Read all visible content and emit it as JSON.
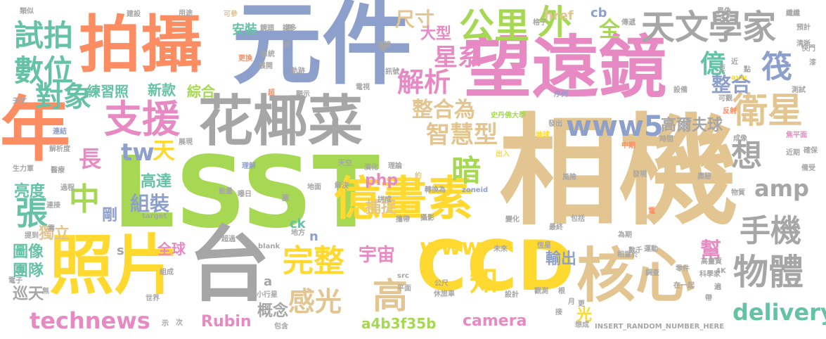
{
  "wordcloud": {
    "words": [
      {
        "text": "相機",
        "color": "#e2c590"
      },
      {
        "text": "LSST",
        "color": "#a6d854"
      },
      {
        "text": "元件",
        "color": "#8da0cb"
      },
      {
        "text": "望遠鏡",
        "color": "#e78ac3"
      },
      {
        "text": "拍攝",
        "color": "#fc8d62"
      },
      {
        "text": "花椰菜",
        "color": "#a6a6a6"
      },
      {
        "text": "CCD",
        "color": "#ffd92f"
      },
      {
        "text": "年",
        "color": "#fc8d62"
      },
      {
        "text": "照片",
        "color": "#ffd92f"
      },
      {
        "text": "台",
        "color": "#a6a6a6"
      },
      {
        "text": "核心",
        "color": "#e2c590"
      },
      {
        "text": "億畫素",
        "color": "#ffd92f"
      },
      {
        "text": "天文學家",
        "color": "#a6a6a6"
      },
      {
        "text": "公里",
        "color": "#a6d854"
      },
      {
        "text": "外",
        "color": "#a6d854"
      },
      {
        "text": "支援",
        "color": "#e78ac3"
      },
      {
        "text": "衛星",
        "color": "#e2c590"
      },
      {
        "text": "www5",
        "color": "#8da0cb"
      },
      {
        "text": "試拍",
        "color": "#66c2a5"
      },
      {
        "text": "數位",
        "color": "#66c2a5"
      },
      {
        "text": "對象",
        "color": "#66c2a5"
      },
      {
        "text": "億",
        "color": "#66c2a5"
      },
      {
        "text": "筏",
        "color": "#8da0cb"
      },
      {
        "text": "星系",
        "color": "#e78ac3"
      },
      {
        "text": "解析",
        "color": "#e78ac3"
      },
      {
        "text": "尺寸",
        "color": "#e2c590"
      },
      {
        "text": "大型",
        "color": "#e78ac3"
      },
      {
        "text": "全",
        "color": "#a6d854"
      },
      {
        "text": "整合",
        "color": "#8da0cb"
      },
      {
        "text": "整合為",
        "color": "#e2c590"
      },
      {
        "text": "智慧型",
        "color": "#e2c590"
      },
      {
        "text": "高爾夫球",
        "color": "#a6a6a6"
      },
      {
        "text": "想",
        "color": "#a6a6a6"
      },
      {
        "text": "amp",
        "color": "#a6a6a6"
      },
      {
        "text": "手機",
        "color": "#a6a6a6"
      },
      {
        "text": "物體",
        "color": "#a6a6a6"
      },
      {
        "text": "delivery",
        "color": "#66c2a5"
      },
      {
        "text": "tw",
        "color": "#8da0cb"
      },
      {
        "text": "天",
        "color": "#ffd92f"
      },
      {
        "text": "長",
        "color": "#e78ac3"
      },
      {
        "text": "暗",
        "color": "#a6d854"
      },
      {
        "text": "php",
        "color": "#e78ac3"
      },
      {
        "text": "中",
        "color": "#a6d854"
      },
      {
        "text": "張",
        "color": "#66c2a5"
      },
      {
        "text": "亮度",
        "color": "#66c2a5"
      },
      {
        "text": "高達",
        "color": "#66c2a5"
      },
      {
        "text": "組裝",
        "color": "#8da0cb"
      },
      {
        "text": "剛",
        "color": "#8da0cb"
      },
      {
        "text": "獨立",
        "color": "#e2c590"
      },
      {
        "text": "圖像",
        "color": "#66c2a5"
      },
      {
        "text": "團隊",
        "color": "#66c2a5"
      },
      {
        "text": "巡天",
        "color": "#a6a6a6"
      },
      {
        "text": "technews",
        "color": "#e78ac3"
      },
      {
        "text": "Rubin",
        "color": "#e78ac3"
      },
      {
        "text": "概念",
        "color": "#a6a6a6"
      },
      {
        "text": "完整",
        "color": "#ffd92f"
      },
      {
        "text": "感光",
        "color": "#e2c590"
      },
      {
        "text": "高",
        "color": "#e2c590"
      },
      {
        "text": "宇宙",
        "color": "#e78ac3"
      },
      {
        "text": "www",
        "color": "#ffd92f"
      },
      {
        "text": "知",
        "color": "#ffd92f"
      },
      {
        "text": "camera",
        "color": "#e78ac3"
      },
      {
        "text": "a4b3f35b",
        "color": "#a6d854"
      },
      {
        "text": "捕捉",
        "color": "#e2c590"
      },
      {
        "text": "輸出",
        "color": "#8da0cb"
      },
      {
        "text": "幫",
        "color": "#e78ac3"
      },
      {
        "text": "光",
        "color": "#ffd92f"
      },
      {
        "text": "全球",
        "color": "#e78ac3"
      },
      {
        "text": "練習照",
        "color": "#66c2a5"
      },
      {
        "text": "新款",
        "color": "#66c2a5"
      },
      {
        "text": "綜合",
        "color": "#a6d854"
      },
      {
        "text": "href",
        "color": "#e2c590"
      },
      {
        "text": "cb",
        "color": "#8da0cb"
      },
      {
        "text": "安裝",
        "color": "#66c2a5"
      },
      {
        "text": "ck",
        "color": "#66c2a5"
      },
      {
        "text": "n",
        "color": "#8da0cb"
      },
      {
        "text": "a",
        "color": "#a6a6a6"
      },
      {
        "text": "s",
        "color": "#a6a6a6"
      },
      {
        "text": "類似",
        "color": "#a6a6a6"
      },
      {
        "text": "建設",
        "color": "#a6a6a6"
      },
      {
        "text": "用途",
        "color": "#a6a6a6"
      },
      {
        "text": "可參",
        "color": "#e2c590"
      },
      {
        "text": "異偽",
        "color": "#a6a6a6"
      },
      {
        "text": "纖纖",
        "color": "#a6a6a6"
      },
      {
        "text": "預計",
        "color": "#a6a6a6"
      },
      {
        "text": "清晰",
        "color": "#a6a6a6"
      },
      {
        "text": "快門",
        "color": "#a6a6a6"
      },
      {
        "text": "測試",
        "color": "#a6a6a6"
      },
      {
        "text": "avw",
        "color": "#ffd92f"
      },
      {
        "text": "設備",
        "color": "#a6a6a6"
      },
      {
        "text": "序列",
        "color": "#8da0cb"
      },
      {
        "text": "電視",
        "color": "#a6a6a6"
      },
      {
        "text": "史丹佛大學",
        "color": "#a6d854"
      },
      {
        "text": "發出",
        "color": "#a6a6a6"
      },
      {
        "text": "焦平面",
        "color": "#e78ac3"
      },
      {
        "text": "反射",
        "color": "#fc8d62"
      },
      {
        "text": "近期",
        "color": "#a6a6a6"
      },
      {
        "text": "確保",
        "color": "#a6a6a6"
      },
      {
        "text": "備受",
        "color": "#a6a6a6"
      },
      {
        "text": "物質",
        "color": "#a6a6a6"
      },
      {
        "text": "奧秘",
        "color": "#a6a6a6"
      },
      {
        "text": "成像",
        "color": "#a6a6a6"
      },
      {
        "text": "發現",
        "color": "#a6a6a6"
      },
      {
        "text": "風險",
        "color": "#a6a6a6"
      },
      {
        "text": "時間",
        "color": "#a6a6a6"
      },
      {
        "text": "中期",
        "color": "#fc8d62"
      },
      {
        "text": "地球",
        "color": "#ffd92f"
      },
      {
        "text": "出入",
        "color": "#ffd92f"
      },
      {
        "text": "生力軍",
        "color": "#a6a6a6"
      },
      {
        "text": "天文",
        "color": "#a6a6a6"
      },
      {
        "text": "醫療",
        "color": "#a6a6a6"
      },
      {
        "text": "連結",
        "color": "#8da0cb"
      },
      {
        "text": "解析度",
        "color": "#a6a6a6"
      },
      {
        "text": "展現",
        "color": "#a6a6a6"
      },
      {
        "text": "理解",
        "color": "#8da0cb"
      },
      {
        "text": "天空",
        "color": "#a6a6a6"
      },
      {
        "text": "演化",
        "color": "#a6a6a6"
      },
      {
        "text": "理論",
        "color": "#a6a6a6"
      },
      {
        "text": "約",
        "color": "#e2c590"
      },
      {
        "text": "轉換為",
        "color": "#a6a6a6"
      },
      {
        "text": "zoneid",
        "color": "#8da0cb"
      },
      {
        "text": "系統",
        "color": "#a6a6a6"
      },
      {
        "text": "更換",
        "color": "#fc8d62"
      },
      {
        "text": "展開",
        "color": "#a6a6a6"
      },
      {
        "text": "軌跡",
        "color": "#a6a6a6"
      },
      {
        "text": "超",
        "color": "#fc8d62"
      },
      {
        "text": "顯示",
        "color": "#a6a6a6"
      },
      {
        "text": "訊號",
        "color": "#a6a6a6"
      },
      {
        "text": "攝影",
        "color": "#a6a6a6"
      },
      {
        "text": "能量",
        "color": "#a6a6a6"
      },
      {
        "text": "曝日",
        "color": "#a6a6a6"
      },
      {
        "text": "解決",
        "color": "#a6a6a6"
      },
      {
        "text": "拼成",
        "color": "#a6a6a6"
      },
      {
        "text": "地面",
        "color": "#a6a6a6"
      },
      {
        "text": "圖",
        "color": "#a6a6a6"
      },
      {
        "text": "攜帶",
        "color": "#a6a6a6"
      },
      {
        "text": "變化",
        "color": "#a6a6a6"
      },
      {
        "text": "包括",
        "color": "#a6a6a6"
      },
      {
        "text": "最終",
        "color": "#a6a6a6"
      },
      {
        "text": "為期",
        "color": "#a6a6a6"
      },
      {
        "text": "數千",
        "color": "#a6a6a6"
      },
      {
        "text": "電",
        "color": "#fc8d62"
      },
      {
        "text": "target",
        "color": "#a6a6a6"
      },
      {
        "text": "連接",
        "color": "#a6a6a6"
      },
      {
        "text": "提到",
        "color": "#a6a6a6"
      },
      {
        "text": "需",
        "color": "#a6a6a6"
      },
      {
        "text": "過程",
        "color": "#a6a6a6"
      },
      {
        "text": "超過",
        "color": "#a6a6a6"
      },
      {
        "text": "地方",
        "color": "#a6a6a6"
      },
      {
        "text": "_blank",
        "color": "#a6a6a6"
      },
      {
        "text": "未來",
        "color": "#a6a6a6"
      },
      {
        "text": "恆星",
        "color": "#a6a6a6"
      },
      {
        "text": "相當於",
        "color": "#a6a6a6"
      },
      {
        "text": "運動",
        "color": "#a6a6a6"
      },
      {
        "text": "調查",
        "color": "#a6a6a6"
      },
      {
        "text": "零件",
        "color": "#a6a6a6"
      },
      {
        "text": "科學家",
        "color": "#a6a6a6"
      },
      {
        "text": "電子",
        "color": "#a6a6a6"
      },
      {
        "text": "組成",
        "color": "#a6a6a6"
      },
      {
        "text": "src",
        "color": "#a6a6a6"
      },
      {
        "text": "公尺",
        "color": "#a6a6a6"
      },
      {
        "text": "平面",
        "color": "#a6a6a6"
      },
      {
        "text": "觀測",
        "color": "#a6a6a6"
      },
      {
        "text": "設計",
        "color": "#a6a6a6"
      },
      {
        "text": "4K",
        "color": "#a6a6a6"
      },
      {
        "text": "在一起",
        "color": "#a6a6a6"
      },
      {
        "text": "高畫質",
        "color": "#a6a6a6"
      },
      {
        "text": "螢幕",
        "color": "#a6a6a6"
      },
      {
        "text": "img",
        "color": "#a6a6a6"
      },
      {
        "text": "小行星",
        "color": "#a6a6a6"
      },
      {
        "text": "休旅車",
        "color": "#a6a6a6"
      },
      {
        "text": "世界",
        "color": "#a6a6a6"
      },
      {
        "text": "次",
        "color": "#a6a6a6"
      },
      {
        "text": "包含",
        "color": "#a6a6a6"
      },
      {
        "text": "月",
        "color": "#a6a6a6"
      },
      {
        "text": "更",
        "color": "#a6a6a6"
      },
      {
        "text": "想成",
        "color": "#a6a6a6"
      },
      {
        "text": "INSERT_RANDOM_NUMBER_HERE",
        "color": "#a6a6a6"
      },
      {
        "text": "帶",
        "color": "#a6a6a6"
      },
      {
        "text": "格子",
        "color": "#a6a6a6"
      },
      {
        "text": "傳遞",
        "color": "#a6a6a6"
      },
      {
        "text": "拼",
        "color": "#a6a6a6"
      },
      {
        "text": "近",
        "color": "#a6a6a6"
      },
      {
        "text": "點",
        "color": "#a6a6a6"
      },
      {
        "text": "源",
        "color": "#a6a6a6"
      },
      {
        "text": "鏡頭",
        "color": "#a6a6a6"
      },
      {
        "text": "諾多",
        "color": "#a6a6a6"
      },
      {
        "text": "濾鏡",
        "color": "#a6a6a6"
      },
      {
        "text": "裡",
        "color": "#a6a6a6"
      },
      {
        "text": "漆",
        "color": "#a6a6a6"
      },
      {
        "text": "亞",
        "color": "#a6a6a6"
      },
      {
        "text": "遍",
        "color": "#a6a6a6"
      },
      {
        "text": "根",
        "color": "#a6a6a6"
      },
      {
        "text": "接",
        "color": "#a6a6a6"
      },
      {
        "text": "無",
        "color": "#a6a6a6"
      },
      {
        "text": "示",
        "color": "#a6a6a6"
      },
      {
        "text": "可觀",
        "color": "#a6a6a6"
      }
    ]
  }
}
